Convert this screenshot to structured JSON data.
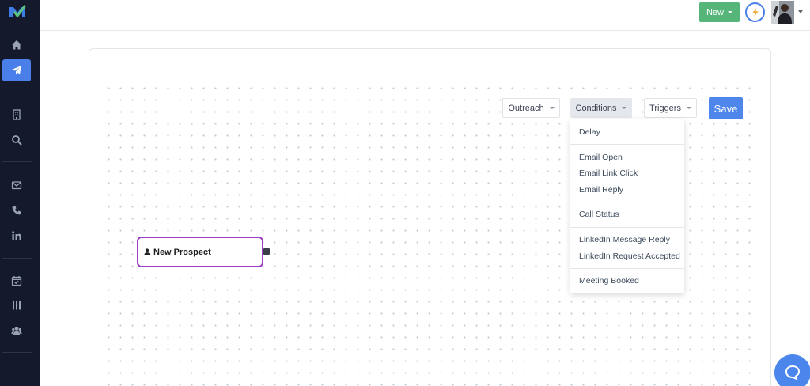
{
  "topbar": {
    "new_label": "New"
  },
  "toolbar": {
    "outreach_label": "Outreach",
    "conditions_label": "Conditions",
    "triggers_label": "Triggers",
    "save_label": "Save"
  },
  "conditions_menu": {
    "items": [
      "Delay",
      "Email Open",
      "Email Link Click",
      "Email Reply",
      "Call Status",
      "LinkedIn Message Reply",
      "LinkedIn Request Accepted",
      "Meeting Booked"
    ]
  },
  "node": {
    "label": "New Prospect"
  },
  "sidebar": {
    "icons": [
      "home-icon",
      "paper-plane-icon",
      "building-icon",
      "search-icon",
      "envelope-icon",
      "phone-icon",
      "linkedin-icon",
      "calendar-icon",
      "columns-icon",
      "users-icon"
    ],
    "active": "paper-plane-icon"
  },
  "colors": {
    "sidebar_bg": "#141a2b",
    "accent": "#4a7ee8",
    "new_button": "#56b679",
    "node_border": "#9b3fc6"
  }
}
